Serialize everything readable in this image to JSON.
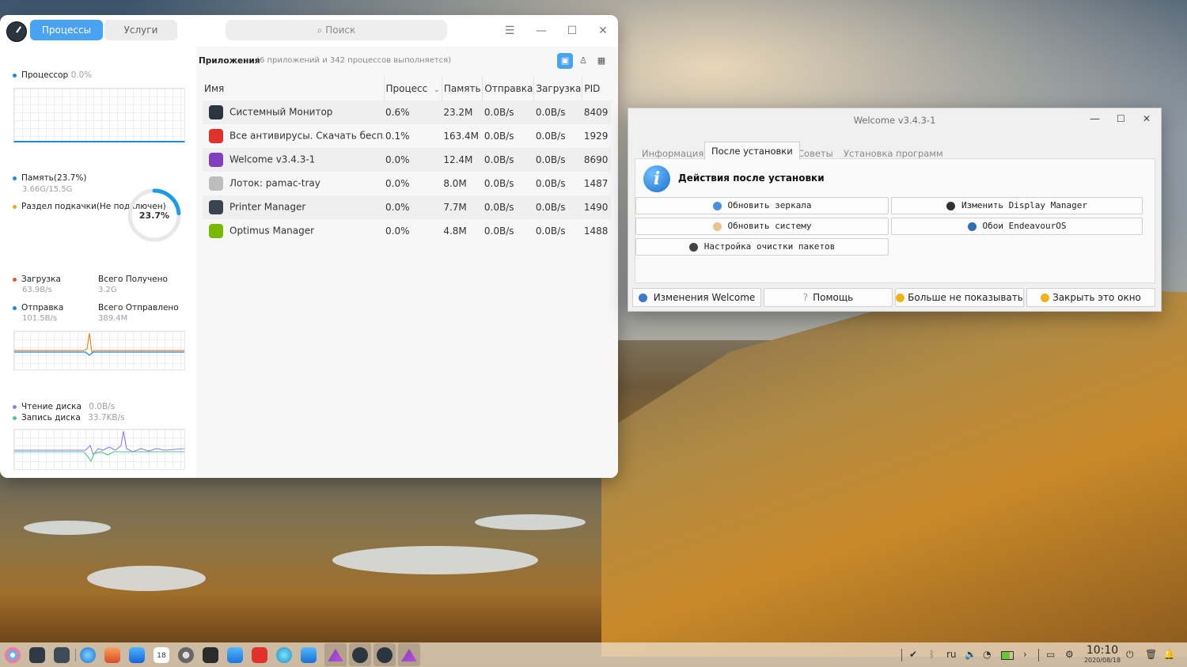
{
  "system_monitor": {
    "tabs": [
      "Процессы",
      "Услуги"
    ],
    "search_placeholder": "Поиск",
    "cpu": {
      "label": "Процессор",
      "value": "0.0%"
    },
    "memory": {
      "label": "Память(23.7%)",
      "value": "3.66G/15.5G",
      "swap_label": "Раздел подкачки(Не подключен)",
      "gauge_percent": "23.7%",
      "gauge_fraction": 0.237
    },
    "network": {
      "download_label": "Загрузка",
      "download_value": "63.9B/s",
      "total_received_label": "Всего Получено",
      "total_received_value": "3.2G",
      "upload_label": "Отправка",
      "upload_value": "101.5B/s",
      "total_sent_label": "Всего Отправлено",
      "total_sent_value": "389.4M"
    },
    "disk": {
      "read_label": "Чтение диска",
      "read_value": "0.0B/s",
      "write_label": "Запись диска",
      "write_value": "33.7KB/s"
    },
    "apps_header": {
      "title": "Приложения",
      "subtitle": "(6 приложений и 342 процессов выполняется)"
    },
    "columns": [
      "Имя",
      "Процесс",
      "Память",
      "Отправка",
      "Загрузка",
      "PID"
    ],
    "rows": [
      {
        "name": "Системный Монитор",
        "cpu": "0.6%",
        "mem": "23.2M",
        "send": "0.0B/s",
        "recv": "0.0B/s",
        "pid": "8409",
        "icon": "system-monitor-icon",
        "color": "#2a3540"
      },
      {
        "name": "Все антивирусы. Скачать беспла...",
        "cpu": "0.1%",
        "mem": "163.4M",
        "send": "0.0B/s",
        "recv": "0.0B/s",
        "pid": "1929",
        "icon": "vivaldi-icon",
        "color": "#e0312b"
      },
      {
        "name": "Welcome v3.4.3-1",
        "cpu": "0.0%",
        "mem": "12.4M",
        "send": "0.0B/s",
        "recv": "0.0B/s",
        "pid": "8690",
        "icon": "endeavouros-icon",
        "color": "#7f3fbf"
      },
      {
        "name": "Лоток: pamac-tray",
        "cpu": "0.0%",
        "mem": "8.0M",
        "send": "0.0B/s",
        "recv": "0.0B/s",
        "pid": "1487",
        "icon": "pamac-tray-icon",
        "color": "#bdbdbd"
      },
      {
        "name": "Printer Manager",
        "cpu": "0.0%",
        "mem": "7.7M",
        "send": "0.0B/s",
        "recv": "0.0B/s",
        "pid": "1490",
        "icon": "printer-icon",
        "color": "#3a4450"
      },
      {
        "name": "Optimus Manager",
        "cpu": "0.0%",
        "mem": "4.8M",
        "send": "0.0B/s",
        "recv": "0.0B/s",
        "pid": "1488",
        "icon": "nvidia-icon",
        "color": "#76b900"
      }
    ]
  },
  "welcome": {
    "title": "Welcome v3.4.3-1",
    "tabs": [
      "Информация",
      "После установки",
      "Советы",
      "Установка программ"
    ],
    "heading": "Действия после установки",
    "buttons": [
      "Обновить зеркала",
      "Изменить Display Manager",
      "Обновить систему",
      "Обои EndeavourOS",
      "Настройка очистки пакетов"
    ],
    "footer": [
      "Изменения Welcome",
      "Помощь",
      "Больше не показывать",
      "Закрыть это окно"
    ]
  },
  "taskbar": {
    "language": "ru",
    "time": "10:10",
    "date": "2020/08/18",
    "calendar_day": "18"
  }
}
